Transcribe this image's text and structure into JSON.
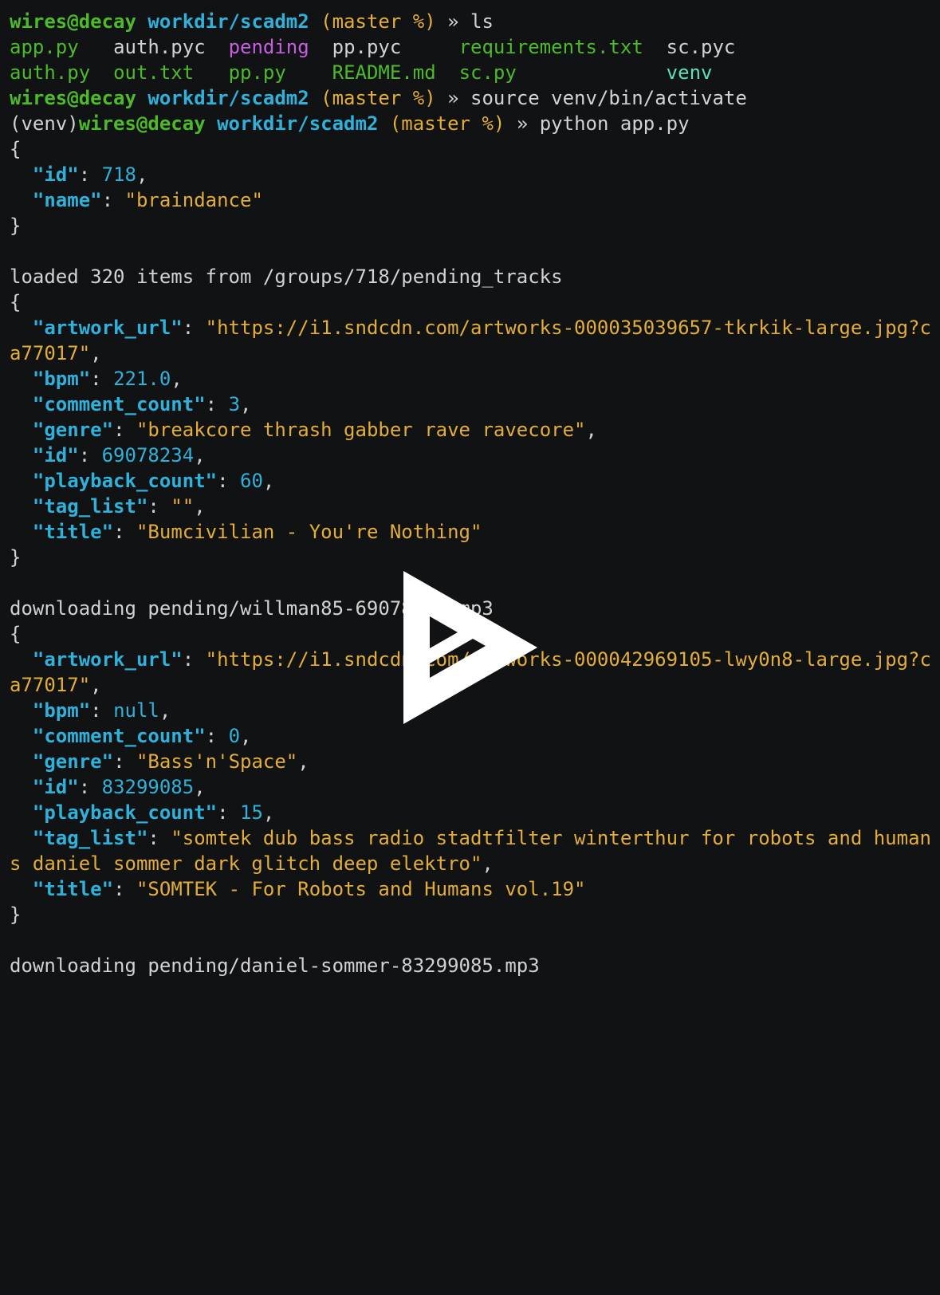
{
  "colors": {
    "background": "#111214",
    "text": "#d2d2d2",
    "green": "#4cba2a",
    "cyan": "#2fb1da",
    "yellow": "#e3ad3a",
    "magenta": "#c75fe0",
    "teal": "#5de0b8",
    "overlay": "#ffffff"
  },
  "prompt": {
    "venv": "(venv)",
    "user": "wires@decay",
    "path": "workdir/scadm2",
    "branch": "(master %)",
    "arrow": "»"
  },
  "commands": {
    "ls": "ls",
    "activate": "source venv/bin/activate",
    "run": "python app.py"
  },
  "ls_output": [
    [
      "app.py",
      "auth.pyc",
      "pending",
      "pp.pyc",
      "requirements.txt",
      "sc.pyc"
    ],
    [
      "auth.py",
      "out.txt",
      "pp.py",
      "README.md",
      "sc.py",
      "venv"
    ]
  ],
  "group": {
    "id": "718",
    "name": "\"braindance\""
  },
  "loaded_message": "loaded 320 items from /groups/718/pending_tracks",
  "tracks": [
    {
      "artwork_url_1": "\"https://i1.sndcdn.com/artworks-000035039657-tkrkik-large.jpg?c",
      "artwork_url_2": "a77017\"",
      "bpm": "221.0",
      "comment_count": "3",
      "genre": "\"breakcore thrash gabber rave ravecore\"",
      "id": "69078234",
      "playback_count": "60",
      "tag_list": "\"\"",
      "title": "\"Bumcivilian - You're Nothing\"",
      "download": "downloading pending/willman85-69078234.mp3"
    },
    {
      "artwork_url_1": "\"https://i1.sndcdn.com/artworks-000042969105-lwy0n8-large.jpg?c",
      "artwork_url_2": "a77017\"",
      "bpm": "null",
      "comment_count": "0",
      "genre": "\"Bass'n'Space\"",
      "id": "83299085",
      "playback_count": "15",
      "tag_list_1": "\"somtek dub bass radio stadtfilter winterthur for robots and human",
      "tag_list_2": "s daniel sommer dark glitch deep elektro\"",
      "title": "\"SOMTEK - For Robots and Humans vol.19\"",
      "download": "downloading pending/daniel-sommer-83299085.mp3"
    }
  ],
  "overlay_icon": "play-logo-icon"
}
